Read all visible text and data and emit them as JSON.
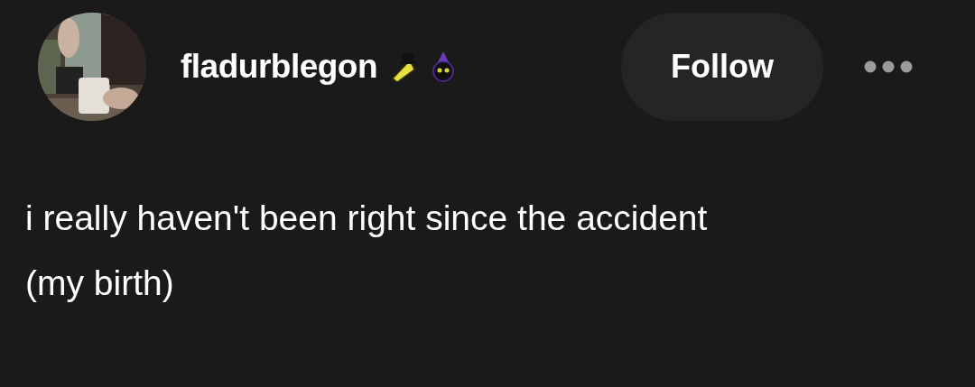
{
  "post": {
    "author": {
      "username": "fladurblegon"
    },
    "follow_button": "Follow",
    "text_lines": [
      "i really haven't been right since the accident",
      "(my birth)"
    ]
  }
}
